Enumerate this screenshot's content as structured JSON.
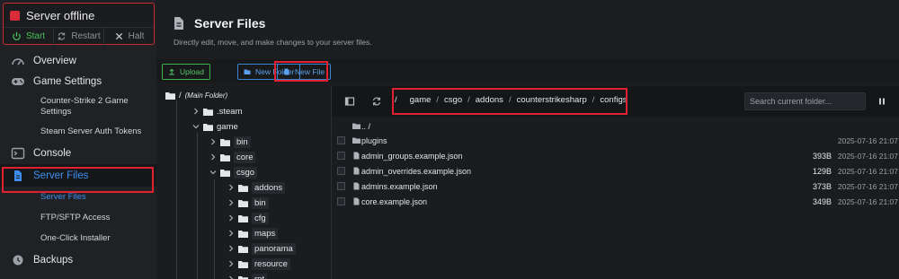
{
  "server": {
    "status": "Server offline",
    "start": "Start",
    "restart": "Restart",
    "halt": "Halt"
  },
  "sidebar": {
    "overview": "Overview",
    "game_settings": "Game Settings",
    "cs2_settings": "Counter-Strike 2 Game Settings",
    "steam_tokens": "Steam Server Auth Tokens",
    "console": "Console",
    "server_files": "Server Files",
    "sub_server_files": "Server Files",
    "ftp": "FTP/SFTP Access",
    "installer": "One-Click Installer",
    "backups": "Backups"
  },
  "page": {
    "title": "Server Files",
    "subtitle": "Directly edit, move, and make changes to your server files."
  },
  "toolbar": {
    "upload": "Upload",
    "new_folder": "New Folder",
    "new_file": "New File"
  },
  "tree": {
    "root": "/",
    "root_label": "(Main Folder)",
    "steam": ".steam",
    "game": "game",
    "bin": "bin",
    "core": "core",
    "csgo": "csgo",
    "addons": "addons",
    "csgo_bin": "bin",
    "cfg": "cfg",
    "maps": "maps",
    "panorama": "panorama",
    "resource": "resource",
    "rpt": "rpt"
  },
  "breadcrumb": {
    "root": "/",
    "p1": "game",
    "p2": "csgo",
    "p3": "addons",
    "p4": "counterstrikesharp",
    "p5": "configs",
    "sep": "/"
  },
  "search": {
    "placeholder": "Search current folder..."
  },
  "files": [
    {
      "name": ".. /",
      "size": "",
      "date": ""
    },
    {
      "name": "plugins",
      "size": "",
      "date": "2025-07-16 21:07"
    },
    {
      "name": "admin_groups.example.json",
      "size": "393B",
      "date": "2025-07-16 21:07"
    },
    {
      "name": "admin_overrides.example.json",
      "size": "129B",
      "date": "2025-07-16 21:07"
    },
    {
      "name": "admins.example.json",
      "size": "373B",
      "date": "2025-07-16 21:07"
    },
    {
      "name": "core.example.json",
      "size": "349B",
      "date": "2025-07-16 21:07"
    }
  ],
  "colors": {
    "accent": "#3d8ff0",
    "highlight": "#e12130",
    "offline": "#d92c3a",
    "success": "#4ac35b"
  }
}
